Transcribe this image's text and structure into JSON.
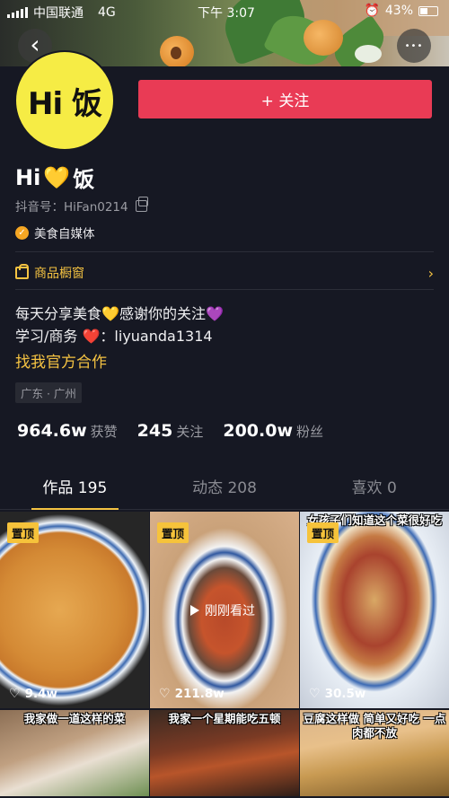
{
  "status_bar": {
    "carrier": "中国联通",
    "network": "4G",
    "time": "下午 3:07",
    "battery": "43%"
  },
  "header": {
    "back_label": "‹",
    "more_label": "•••"
  },
  "profile": {
    "avatar_text": "Hi 饭",
    "follow_label": "+ 关注",
    "nickname_pre": "Hi",
    "nickname_heart": "💛",
    "nickname_post": "饭",
    "douyin_id": "抖音号：HiFan0214",
    "verification": "美食自媒体",
    "shop_window": "商品橱窗",
    "bio_line1_a": "每天分享美食",
    "bio_line1_heart1": "💛",
    "bio_line1_b": "感谢你的关注",
    "bio_line1_heart2": "💜",
    "bio_line2_a": "学习/商务",
    "bio_line2_heart": "❤️",
    "bio_line2_b": "：liyuanda1314",
    "contact_link": "找我官方合作",
    "location": "广东 · 广州"
  },
  "stats": [
    {
      "num": "964.6w",
      "label": "获赞"
    },
    {
      "num": "245",
      "label": "关注"
    },
    {
      "num": "200.0w",
      "label": "粉丝"
    }
  ],
  "tabs": [
    {
      "label": "作品 195"
    },
    {
      "label": "动态 208"
    },
    {
      "label": "喜欢 0"
    }
  ],
  "videos": [
    {
      "pin": "置顶",
      "likes": "9.4w",
      "overlay": ""
    },
    {
      "pin": "置顶",
      "likes": "211.8w",
      "overlay": "",
      "watched": "刚刚看过"
    },
    {
      "pin": "置顶",
      "likes": "30.5w",
      "overlay": "女孩子们知道这个菜很好吃"
    },
    {
      "pin": "",
      "likes": "",
      "overlay": "我家做一道这样的菜"
    },
    {
      "pin": "",
      "likes": "",
      "overlay": "我家一个星期能吃五顿"
    },
    {
      "pin": "",
      "likes": "",
      "overlay": "豆腐这样做 简单又好吃 一点肉都不放"
    }
  ],
  "colors": {
    "accent_yellow": "#f5c342",
    "follow_red": "#e93b55",
    "background": "#161823"
  }
}
